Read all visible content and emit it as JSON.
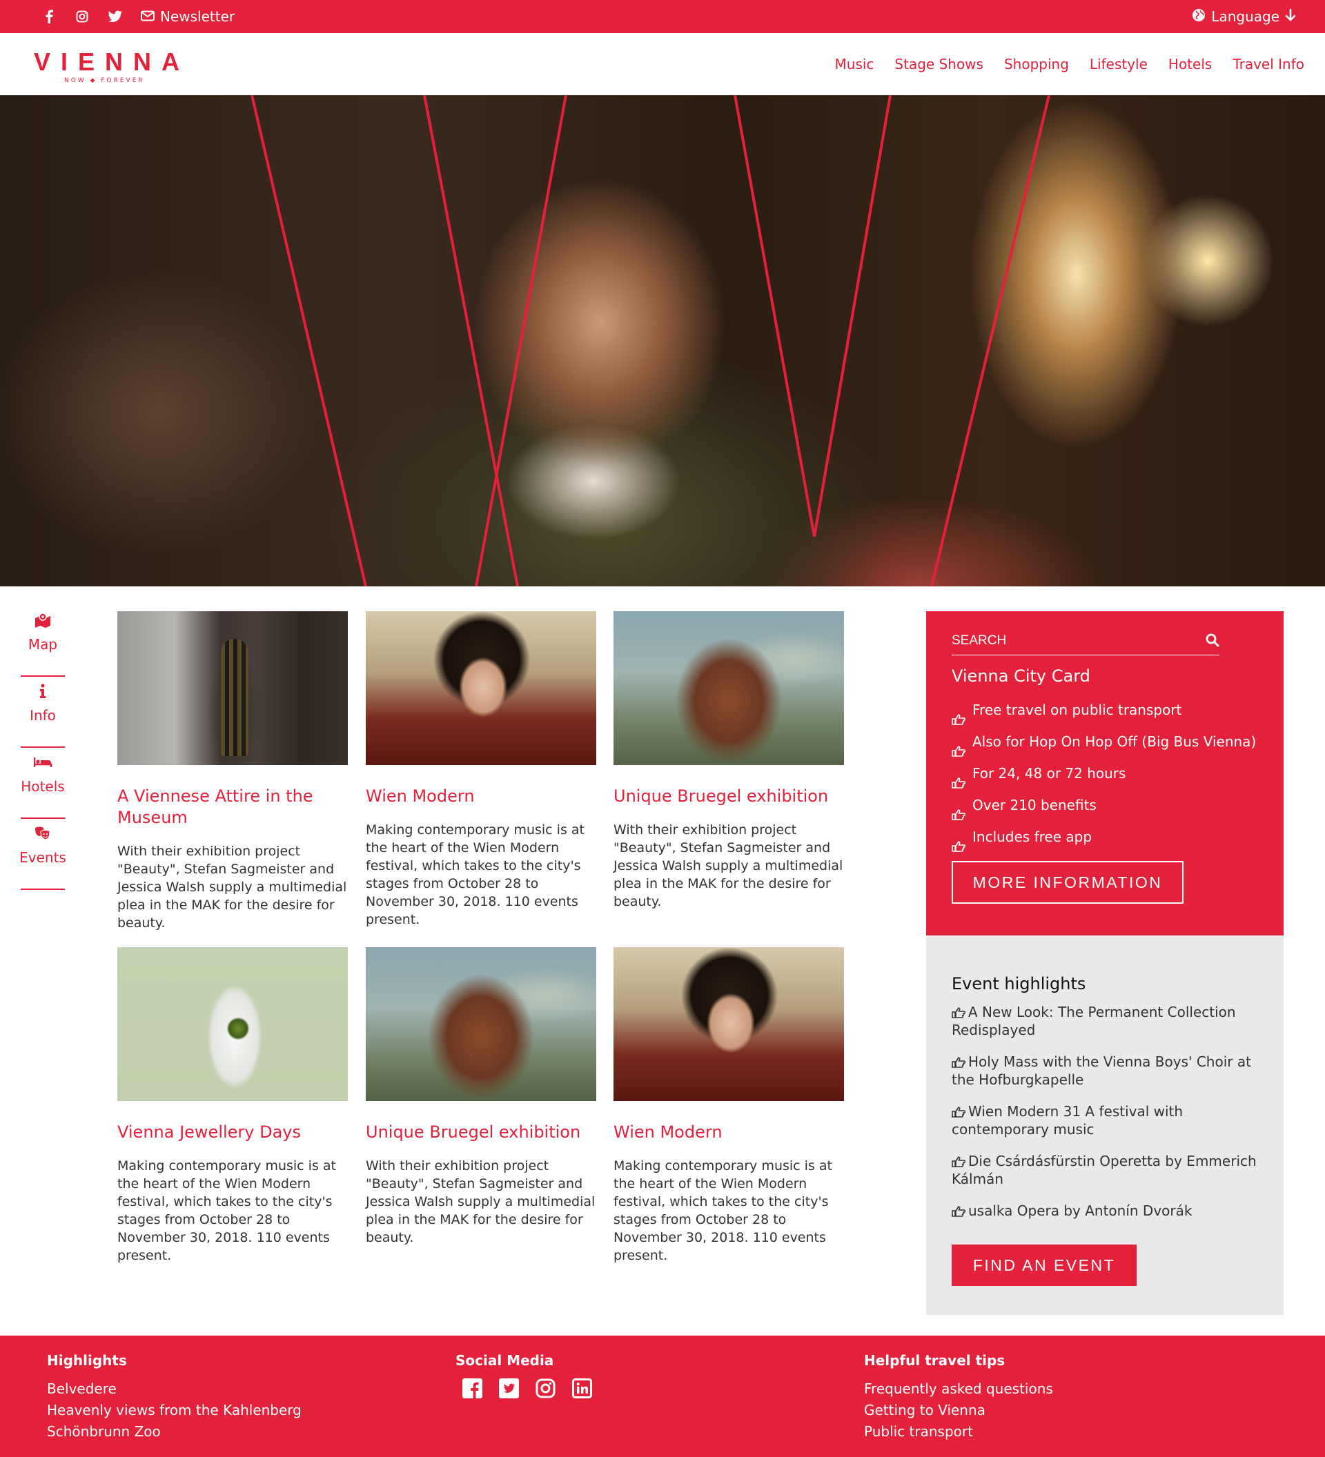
{
  "topbar": {
    "newsletter_label": "Newsletter",
    "language_label": "Language",
    "social_icons": [
      "facebook-icon",
      "instagram-icon",
      "twitter-icon"
    ]
  },
  "brand": {
    "name": "VIENNA",
    "tagline": "NOW ◆ FOREVER",
    "color": "#e4213a"
  },
  "nav": {
    "items": [
      "Music",
      "Stage Shows",
      "Shopping",
      "Lifestyle",
      "Hotels",
      "Travel Info"
    ]
  },
  "leftnav": {
    "items": [
      {
        "label": "Map",
        "icon": "map-icon"
      },
      {
        "label": "Info",
        "icon": "info-icon"
      },
      {
        "label": "Hotels",
        "icon": "bed-icon"
      },
      {
        "label": "Events",
        "icon": "theater-masks-icon"
      }
    ]
  },
  "cards": [
    {
      "title": "A Viennese Attire in the Museum",
      "text": "With their exhibition project \"Beauty\", Stefan Sagmeister and Jessica Walsh supply a multimedial plea in the MAK for the desire for beauty."
    },
    {
      "title": "Wien Modern",
      "text": "Making contemporary music is at the heart of the Wien Modern festival, which takes to the city's stages from October 28 to November 30, 2018. 110 events present."
    },
    {
      "title": "Unique Bruegel exhibition",
      "text": "With their exhibition project \"Beauty\", Stefan Sagmeister and Jessica Walsh supply a multimedial plea in the MAK for the desire for beauty."
    },
    {
      "title": "Vienna Jewellery Days",
      "text": "Making contemporary music is at the heart of the Wien Modern festival, which takes to the city's stages from October 28 to November 30, 2018. 110 events present."
    },
    {
      "title": "Unique Bruegel exhibition",
      "text": "With their exhibition project \"Beauty\", Stefan Sagmeister and Jessica Walsh supply a multimedial plea in the MAK for the desire for beauty."
    },
    {
      "title": "Wien Modern",
      "text": "Making contemporary music is at the heart of the Wien Modern festival, which takes to the city's stages from October 28 to November 30, 2018. 110 events present."
    }
  ],
  "citycard": {
    "search_placeholder": "SEARCH",
    "title": "Vienna City Card",
    "items": [
      "Free travel on public transport",
      "Also for Hop On Hop Off (Big Bus Vienna)",
      "For 24, 48 or 72 hours",
      "Over 210 benefits",
      "Includes free app"
    ],
    "button_label": "MORE INFORMATION"
  },
  "highlights": {
    "title": "Event highlights",
    "items": [
      "A New Look: The Permanent Collection Redisplayed",
      "Holy Mass with the Vienna Boys' Choir at the Hofburgkapelle",
      "Wien Modern 31 A festival with contemporary music",
      "Die Csárdásfürstin Operetta by Emmerich Kálmán",
      "usalka Opera by Antonín Dvorák"
    ],
    "button_label": "FIND AN EVENT"
  },
  "footer": {
    "highlights": {
      "title": "Highlights",
      "links": [
        "Belvedere",
        "Heavenly views from the Kahlenberg",
        "Schönbrunn Zoo"
      ]
    },
    "social": {
      "title": "Social Media",
      "icons": [
        "facebook-square-icon",
        "twitter-square-icon",
        "instagram-icon",
        "linkedin-icon"
      ]
    },
    "tips": {
      "title": "Helpful travel tips",
      "links": [
        "Frequently asked questions",
        "Getting to Vienna",
        "Public transport"
      ]
    }
  }
}
